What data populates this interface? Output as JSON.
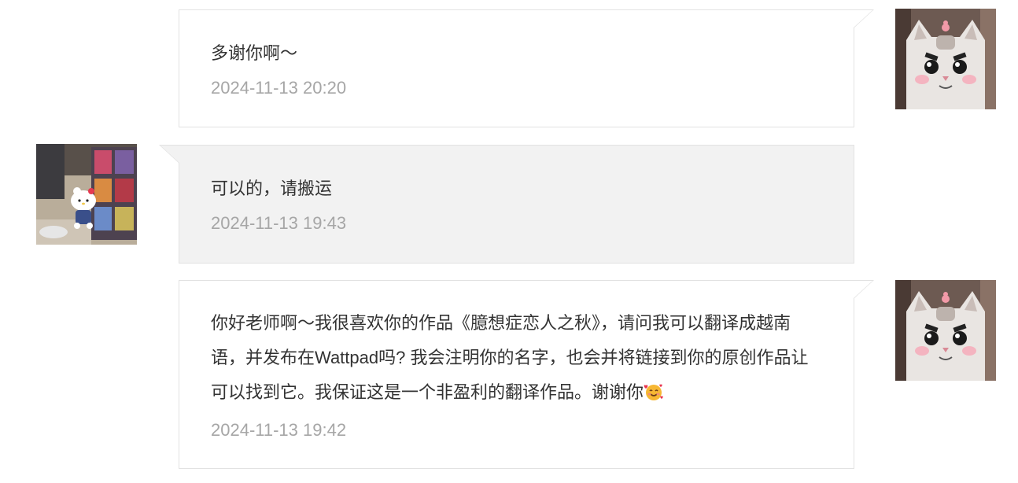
{
  "messages": [
    {
      "side": "right",
      "text": "多谢你啊～",
      "time": "2024-11-13 20:20",
      "avatar_icon": "cat-avatar-icon"
    },
    {
      "side": "left",
      "text": "可以的，请搬运",
      "time": "2024-11-13 19:43",
      "avatar_icon": "hello-kitty-avatar-icon"
    },
    {
      "side": "right",
      "text": "你好老师啊～我很喜欢你的作品《臆想症恋人之秋》，请问我可以翻译成越南语，并发布在Wattpad吗? 我会注明你的名字，也会并将链接到你的原创作品让可以找到它。我保证这是一个非盈利的翻译作品。谢谢你",
      "emoji_icon": "smiling-face-with-hearts-icon",
      "time": "2024-11-13 19:42",
      "avatar_icon": "cat-avatar-icon"
    }
  ],
  "colors": {
    "sent_bubble_bg": "#ffffff",
    "received_bubble_bg": "#f2f2f2",
    "border": "#e2e2e2",
    "text": "#333333",
    "timestamp": "#a6a6a6"
  }
}
